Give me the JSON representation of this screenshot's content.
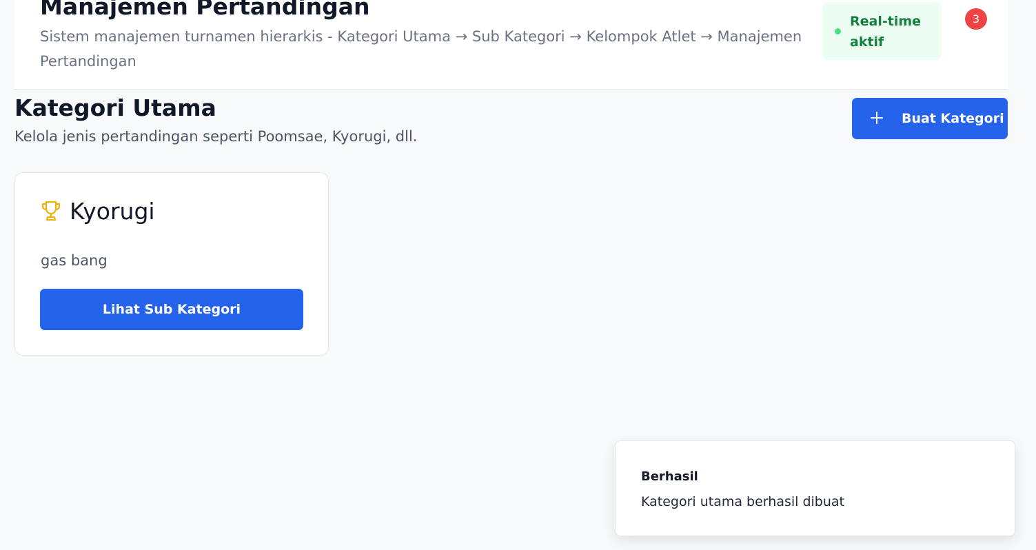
{
  "header": {
    "title": "Manajemen Pertandingan",
    "subtitle": "Sistem manajemen turnamen hierarkis - Kategori Utama → Sub Kategori → Kelompok Atlet → Manajemen Pertandingan",
    "realtime_label": "Real-time aktif",
    "notification_count": "3"
  },
  "section": {
    "title": "Kategori Utama",
    "subtitle": "Kelola jenis pertandingan seperti Poomsae, Kyorugi, dll.",
    "create_button_label": "Buat Kategori"
  },
  "categories": [
    {
      "name": "Kyorugi",
      "description": "gas bang",
      "icon": "trophy-icon",
      "action_label": "Lihat Sub Kategori"
    }
  ],
  "toast": {
    "title": "Berhasil",
    "message": "Kategori utama berhasil dibuat"
  },
  "colors": {
    "primary": "#2563eb",
    "success_bg": "#ecfdf3",
    "success_text": "#15803d",
    "danger": "#ef4444",
    "trophy": "#eab308"
  }
}
